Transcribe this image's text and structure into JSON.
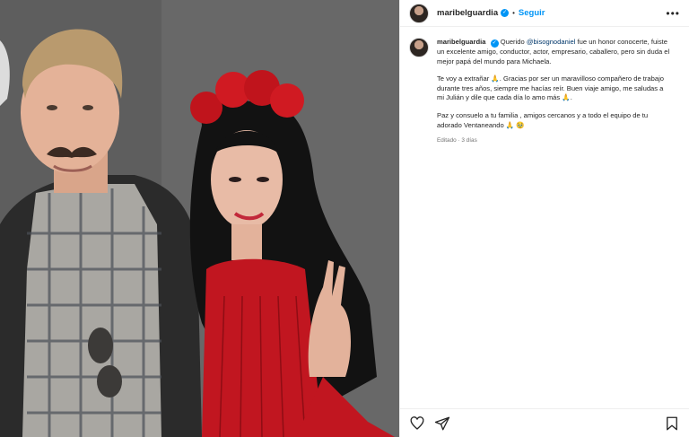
{
  "post": {
    "username": "maribelguardia",
    "follow_label": "Seguir",
    "separator": "•",
    "more_label": "•••",
    "caption": {
      "username": "maribelguardia",
      "p1_start": "Querido ",
      "mention": "@bisognodaniel",
      "p1_rest": " fue un honor conocerte, fuiste un excelente amigo, conductor, actor, empresario, caballero, pero sin duda el mejor papá del mundo para Michaela.",
      "p2_a": "Te voy a extrañar 🙏. Gracias por ser un maravilloso compañero de trabajo durante tres años, siempre me hacías reír. Buen viaje amigo, me saludas a mi Julián y dile que cada día lo amo más 🙏.",
      "p3": "Paz y consuelo a tu familia , amigos cercanos y a todo el equipo de tu adorado Ventaneando 🙏 🥹"
    },
    "edited_label": "Editado · 3 días"
  },
  "colors": {
    "accent": "#0095f6",
    "mention": "#00376b",
    "muted": "#737373"
  },
  "icons": {
    "like": "heart-icon",
    "share": "paper-plane-icon",
    "save": "bookmark-icon",
    "verified": "verified-badge-icon",
    "more": "more-options-icon"
  }
}
